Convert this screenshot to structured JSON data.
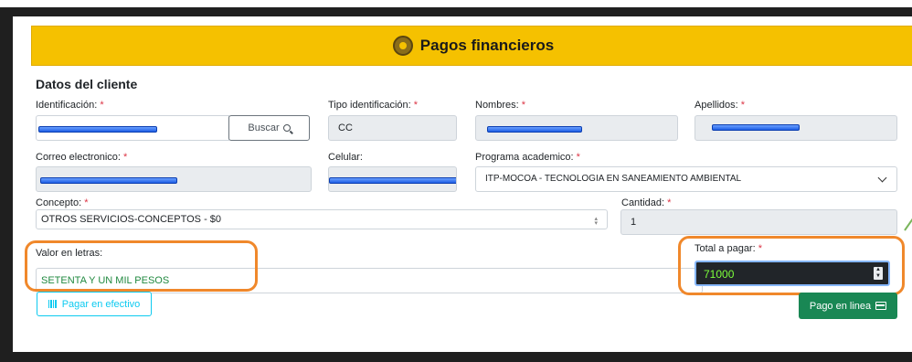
{
  "banner": {
    "title": "Pagos financieros"
  },
  "section": {
    "title": "Datos del cliente"
  },
  "fields": {
    "identificacion": {
      "label": "Identificación:",
      "required": "*"
    },
    "buscar": {
      "label": "Buscar"
    },
    "tipo_identificacion": {
      "label": "Tipo identificación:",
      "required": "*",
      "value": "CC"
    },
    "nombres": {
      "label": "Nombres:",
      "required": "*"
    },
    "apellidos": {
      "label": "Apellidos:",
      "required": "*"
    },
    "correo": {
      "label": "Correo electronico:",
      "required": "*"
    },
    "celular": {
      "label": "Celular:"
    },
    "programa": {
      "label": "Programa academico:",
      "required": "*",
      "value": "ITP-MOCOA - TECNOLOGIA EN SANEAMIENTO AMBIENTAL"
    },
    "concepto": {
      "label": "Concepto:",
      "required": "*",
      "value": "OTROS SERVICIOS-CONCEPTOS - $0"
    },
    "cantidad": {
      "label": "Cantidad:",
      "required": "*",
      "value": "1"
    },
    "valor_letras": {
      "label": "Valor en letras:",
      "value": "SETENTA Y UN MIL PESOS"
    },
    "total": {
      "label": "Total a pagar:",
      "required": "*",
      "value": "71000"
    }
  },
  "buttons": {
    "efectivo": "Pagar en efectivo",
    "linea": "Pago en linea"
  },
  "colors": {
    "banner": "#f5c100",
    "highlight": "#f0882b",
    "success": "#198754",
    "info": "#0dcaf0"
  }
}
